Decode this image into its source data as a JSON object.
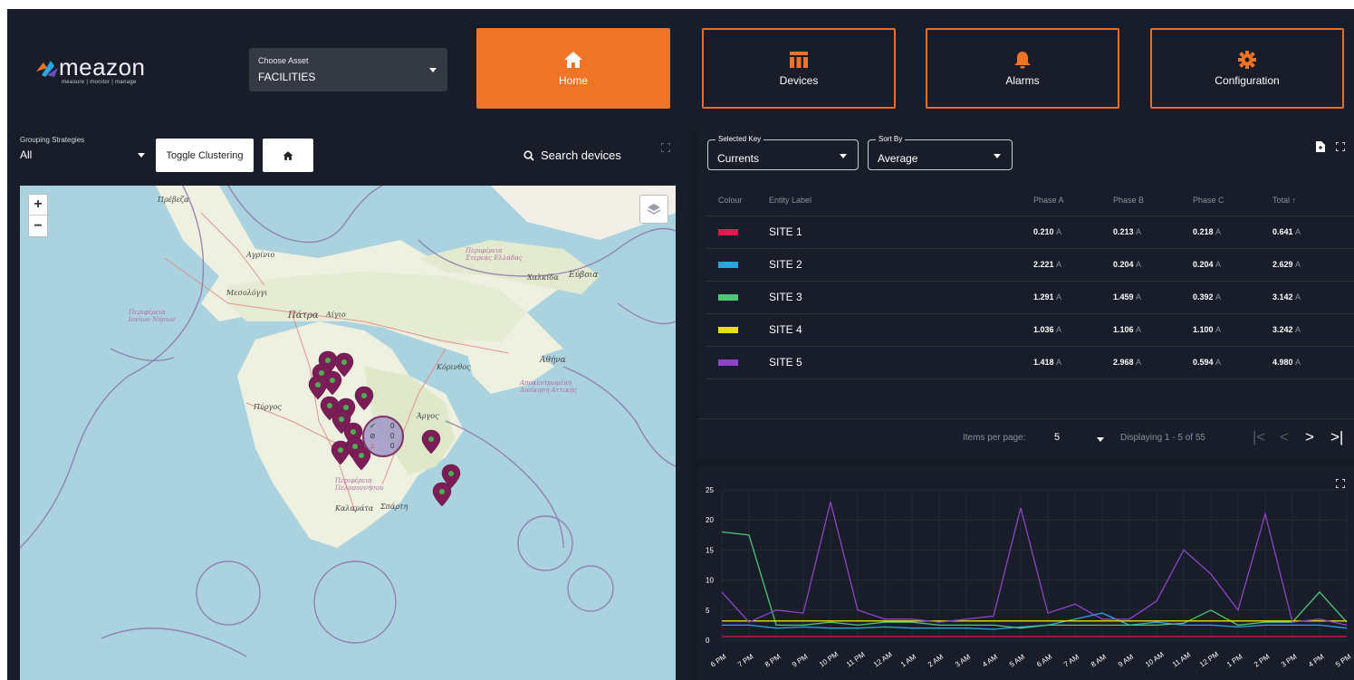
{
  "header": {
    "logo_word": "meazon",
    "logo_tagline": "measure | monitor | manage",
    "asset_label": "Choose Asset",
    "asset_value": "FACILITIES",
    "nav": [
      {
        "label": "Home",
        "icon": "home-icon",
        "active": true
      },
      {
        "label": "Devices",
        "icon": "devices-icon",
        "active": false
      },
      {
        "label": "Alarms",
        "icon": "bell-icon",
        "active": false
      },
      {
        "label": "Configuration",
        "icon": "gear-icon",
        "active": false
      }
    ]
  },
  "left": {
    "grouping_label": "Grouping Strategies",
    "grouping_value": "All",
    "toggle_label": "Toggle Clustering",
    "search_label": "Search devices",
    "map": {
      "zoom_in": "+",
      "zoom_out": "−",
      "cluster": {
        "ok": "0",
        "comm": "0",
        "alarm": "0"
      },
      "place_labels": [
        "Πρέβεζα",
        "Αγρίνιο",
        "Περιφέρεια Στερεάς Ελλάδας",
        "Χαλκίδα",
        "Εύβοια",
        "Μεσολόγγι",
        "Περιφέρεια Ιονίων Νήσων",
        "Πάτρα",
        "Αίγιο",
        "Κόρινθος",
        "Αθήνα",
        "Αποκεντρωμένη Διοίκηση Αττικής",
        "Πύργος",
        "Άργος",
        "Περιφέρεια Πελοποννήσου",
        "Καλαμάτα",
        "Σπάρτη"
      ]
    }
  },
  "table": {
    "selected_key_label": "Selected Key",
    "selected_key_value": "Currents",
    "sort_by_label": "Sort By",
    "sort_by_value": "Average",
    "columns": [
      "Colour",
      "Entity Label",
      "Phase A",
      "Phase B",
      "Phase C",
      "Total ↑"
    ],
    "unit": "A",
    "rows": [
      {
        "color": "#e8174f",
        "label": "SITE 1",
        "a": "0.210",
        "b": "0.213",
        "c": "0.218",
        "total": "0.641"
      },
      {
        "color": "#29a6e2",
        "label": "SITE 2",
        "a": "2.221",
        "b": "0.204",
        "c": "0.204",
        "total": "2.629"
      },
      {
        "color": "#4dc77a",
        "label": "SITE 3",
        "a": "1.291",
        "b": "1.459",
        "c": "0.392",
        "total": "3.142"
      },
      {
        "color": "#e9e00f",
        "label": "SITE 4",
        "a": "1.036",
        "b": "1.106",
        "c": "1.100",
        "total": "3.242"
      },
      {
        "color": "#8e44c6",
        "label": "SITE 5",
        "a": "1.418",
        "b": "2.968",
        "c": "0.594",
        "total": "4.980"
      }
    ],
    "pager": {
      "items_per_page_label": "Items per page:",
      "items_per_page_value": "5",
      "displaying": "Displaying 1 - 5 of 55",
      "first": "|<",
      "prev": "<",
      "next": ">",
      "last": ">|"
    }
  },
  "chart_data": {
    "type": "line",
    "title": "",
    "ylim": [
      0,
      25
    ],
    "yticks": [
      0,
      5,
      10,
      15,
      20,
      25
    ],
    "x": [
      "6 PM",
      "7 PM",
      "8 PM",
      "9 PM",
      "10 PM",
      "11 PM",
      "12 AM",
      "1 AM",
      "2 AM",
      "3 AM",
      "4 AM",
      "5 AM",
      "6 AM",
      "7 AM",
      "8 AM",
      "9 AM",
      "10 AM",
      "11 AM",
      "12 PM",
      "1 PM",
      "2 PM",
      "3 PM",
      "4 PM",
      "5 PM"
    ],
    "series": [
      {
        "color": "#e8174f",
        "values": [
          0.6,
          0.6,
          0.6,
          0.6,
          0.6,
          0.6,
          0.6,
          0.6,
          0.6,
          0.6,
          0.6,
          0.6,
          0.6,
          0.6,
          0.6,
          0.6,
          0.6,
          0.6,
          0.6,
          0.6,
          0.6,
          0.6,
          0.6,
          0.6
        ]
      },
      {
        "color": "#29a6e2",
        "values": [
          2.5,
          2.5,
          2.0,
          2.2,
          2.0,
          2.0,
          2.2,
          2.0,
          2.0,
          2.0,
          1.8,
          2.2,
          2.5,
          3.5,
          4.5,
          2.5,
          3.0,
          2.5,
          2.5,
          2.2,
          2.5,
          2.5,
          2.5,
          2.0
        ]
      },
      {
        "color": "#4dc77a",
        "values": [
          18,
          17.5,
          2.5,
          2.5,
          3.0,
          2.5,
          3.0,
          3.0,
          2.5,
          2.5,
          2.5,
          2.0,
          2.5,
          2.5,
          2.5,
          2.5,
          2.5,
          2.8,
          5.0,
          2.5,
          3.0,
          3.0,
          8.0,
          3.0
        ]
      },
      {
        "color": "#e9e00f",
        "values": [
          3.2,
          3.2,
          3.2,
          3.2,
          3.2,
          3.2,
          3.2,
          3.2,
          3.2,
          3.2,
          3.2,
          3.2,
          3.2,
          3.2,
          3.2,
          3.2,
          3.2,
          3.2,
          3.2,
          3.2,
          3.2,
          3.2,
          3.2,
          3.2
        ]
      },
      {
        "color": "#8e44c6",
        "values": [
          8.0,
          3.0,
          5.0,
          4.5,
          23,
          5.0,
          3.5,
          3.5,
          3.0,
          3.5,
          4.0,
          22,
          4.5,
          6.0,
          3.5,
          3.5,
          6.5,
          15,
          11,
          5.0,
          21,
          3.0,
          3.5,
          2.5
        ]
      }
    ]
  }
}
